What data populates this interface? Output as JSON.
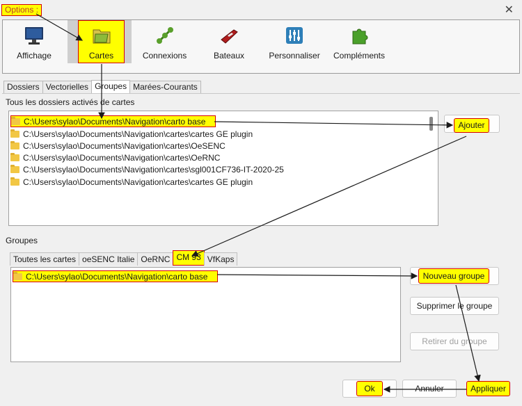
{
  "title_annotation": "Options :",
  "toolbar": {
    "items": [
      {
        "label": "Affichage",
        "icon": "monitor-icon"
      },
      {
        "label": "Cartes",
        "icon": "map-folder-icon"
      },
      {
        "label": "Connexions",
        "icon": "connections-icon"
      },
      {
        "label": "Bateaux",
        "icon": "boat-icon"
      },
      {
        "label": "Personnaliser",
        "icon": "sliders-icon"
      },
      {
        "label": "Compléments",
        "icon": "puzzle-icon"
      }
    ]
  },
  "tabs": [
    "Dossiers",
    "Vectorielles",
    "Groupes",
    "Marées-Courants"
  ],
  "active_tab": "Groupes",
  "folders_section": {
    "label": "Tous les dossiers activés de cartes",
    "items": [
      "C:\\Users\\sylao\\Documents\\Navigation\\carto base",
      "C:\\Users\\sylao\\Documents\\Navigation\\cartes\\cartes GE plugin",
      "C:\\Users\\sylao\\Documents\\Navigation\\cartes\\OeSENC",
      "C:\\Users\\sylao\\Documents\\Navigation\\cartes\\OeRNC",
      "C:\\Users\\sylao\\Documents\\Navigation\\cartes\\sgl001CF736-IT-2020-25",
      "C:\\Users\\sylao\\Documents\\Navigation\\cartes\\cartes GE plugin"
    ],
    "add_button": "Ajouter"
  },
  "groups_section": {
    "label": "Groupes",
    "tabs": [
      "Toutes les cartes",
      "oeSENC Italie",
      "OeRNC",
      "CM 93",
      "VfKaps"
    ],
    "active_tab": "CM 93",
    "items": [
      "C:\\Users\\sylao\\Documents\\Navigation\\carto base"
    ],
    "new_group": "Nouveau groupe",
    "delete_group": "Supprimer le groupe",
    "remove_from_group": "Retirer du groupe"
  },
  "footer": {
    "ok": "Ok",
    "cancel": "Annuler",
    "apply": "Appliquer"
  },
  "colors": {
    "highlight": "#ffff00",
    "highlight_border": "#d40000",
    "arrow": "#1a1a1a"
  }
}
